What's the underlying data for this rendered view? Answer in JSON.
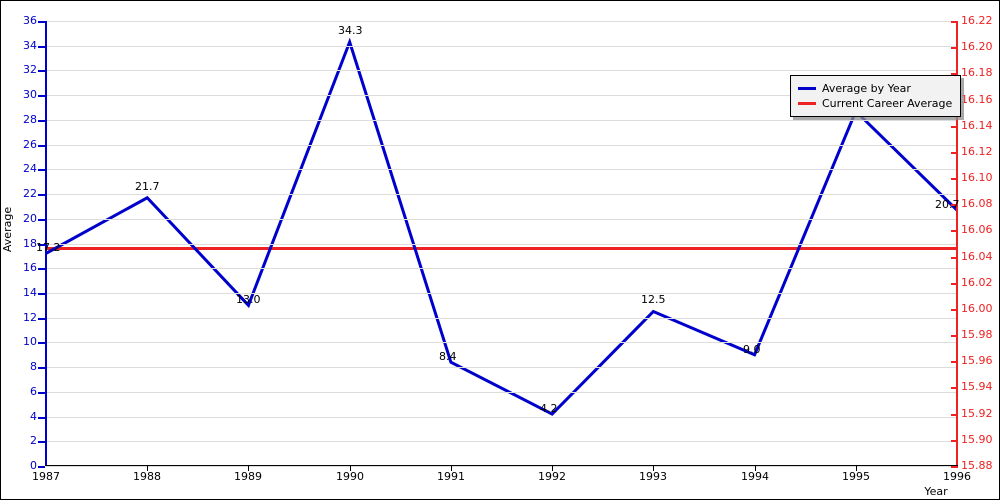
{
  "chart_data": {
    "type": "line",
    "title": "",
    "xlabel": "Year",
    "ylabel": "Average",
    "grid": true,
    "legend_position": "top-right",
    "categories": [
      "1987",
      "1988",
      "1989",
      "1990",
      "1991",
      "1992",
      "1993",
      "1994",
      "1995",
      "1996"
    ],
    "x": [
      1987,
      1988,
      1989,
      1990,
      1991,
      1992,
      1993,
      1994,
      1995,
      1996
    ],
    "xlim": [
      1987,
      1996
    ],
    "ylim": [
      0,
      36
    ],
    "y_ticks": [
      0,
      2,
      4,
      6,
      8,
      10,
      12,
      14,
      16,
      18,
      20,
      22,
      24,
      26,
      28,
      30,
      32,
      34,
      36
    ],
    "y_tick_labels": [
      "0",
      "2",
      "4",
      "6",
      "8",
      "10",
      "12",
      "14",
      "16",
      "18",
      "20",
      "22",
      "24",
      "26",
      "28",
      "30",
      "32",
      "34",
      "36"
    ],
    "y2_label": "",
    "y2lim": [
      15.88,
      16.22
    ],
    "y2_ticks": [
      15.88,
      15.9,
      15.92,
      15.94,
      15.96,
      15.98,
      16.0,
      16.02,
      16.04,
      16.06,
      16.08,
      16.1,
      16.12,
      16.14,
      16.16,
      16.18,
      16.2,
      16.22
    ],
    "y2_tick_labels": [
      "15.88",
      "15.90",
      "15.92",
      "15.94",
      "15.96",
      "15.98",
      "16.00",
      "16.02",
      "16.04",
      "16.06",
      "16.08",
      "16.10",
      "16.12",
      "16.14",
      "16.16",
      "16.18",
      "16.20",
      "16.22"
    ],
    "series": [
      {
        "name": "Average by Year",
        "color": "#0000cc",
        "axis": "left",
        "values": [
          17.2,
          21.7,
          13.0,
          34.3,
          8.4,
          4.2,
          12.5,
          9.0,
          28.7,
          20.7
        ],
        "point_labels": [
          "17.2",
          "21.7",
          "13.0",
          "34.3",
          "8.4",
          "4.2",
          "12.5",
          "9.0",
          "28.7",
          "20.7"
        ]
      },
      {
        "name": "Current Career Average",
        "color": "#ee2222",
        "axis": "left",
        "constant_value": 17.6,
        "constant_value_right_axis": 16.043
      }
    ]
  },
  "legend": {
    "items": [
      {
        "label": "Average by Year",
        "color": "#0000cc"
      },
      {
        "label": "Current Career Average",
        "color": "#ee2222"
      }
    ]
  },
  "axes": {
    "left_axis_color": "#0000cc",
    "right_axis_color": "#ee2222",
    "bottom_axis_color": "#000000",
    "grid_color": "#dcdcdc"
  }
}
